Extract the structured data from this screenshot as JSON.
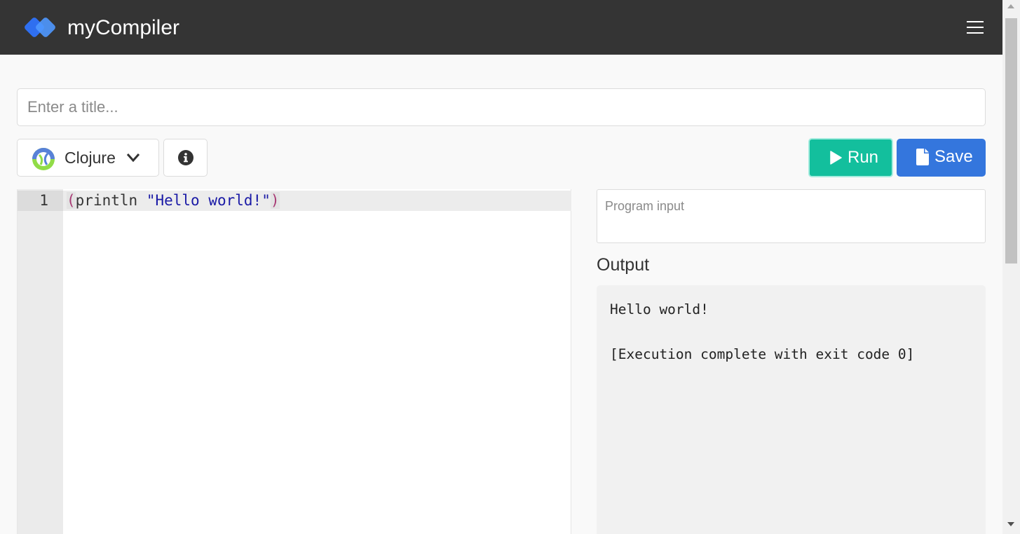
{
  "header": {
    "brand_name": "myCompiler",
    "logo_icon": "diamond-logo-icon",
    "menu_icon": "hamburger-menu-icon",
    "background": "#343434"
  },
  "title_input": {
    "placeholder": "Enter a title...",
    "value": ""
  },
  "toolbar": {
    "language_label": "Clojure",
    "language_icon": "clojure-logo-icon",
    "info_icon": "info-circle-icon",
    "run_label": "Run",
    "run_icon": "play-icon",
    "save_label": "Save",
    "save_icon": "file-icon",
    "run_color": "#13bf9d",
    "save_color": "#3476dd"
  },
  "editor": {
    "line_numbers": [
      "1"
    ],
    "code": {
      "open_paren": "(",
      "function": "println",
      "string": "\"Hello world!\"",
      "close_paren": ")"
    }
  },
  "program_input": {
    "placeholder": "Program input",
    "value": ""
  },
  "output": {
    "heading": "Output",
    "lines": [
      "Hello world!",
      "",
      "[Execution complete with exit code 0]"
    ]
  }
}
